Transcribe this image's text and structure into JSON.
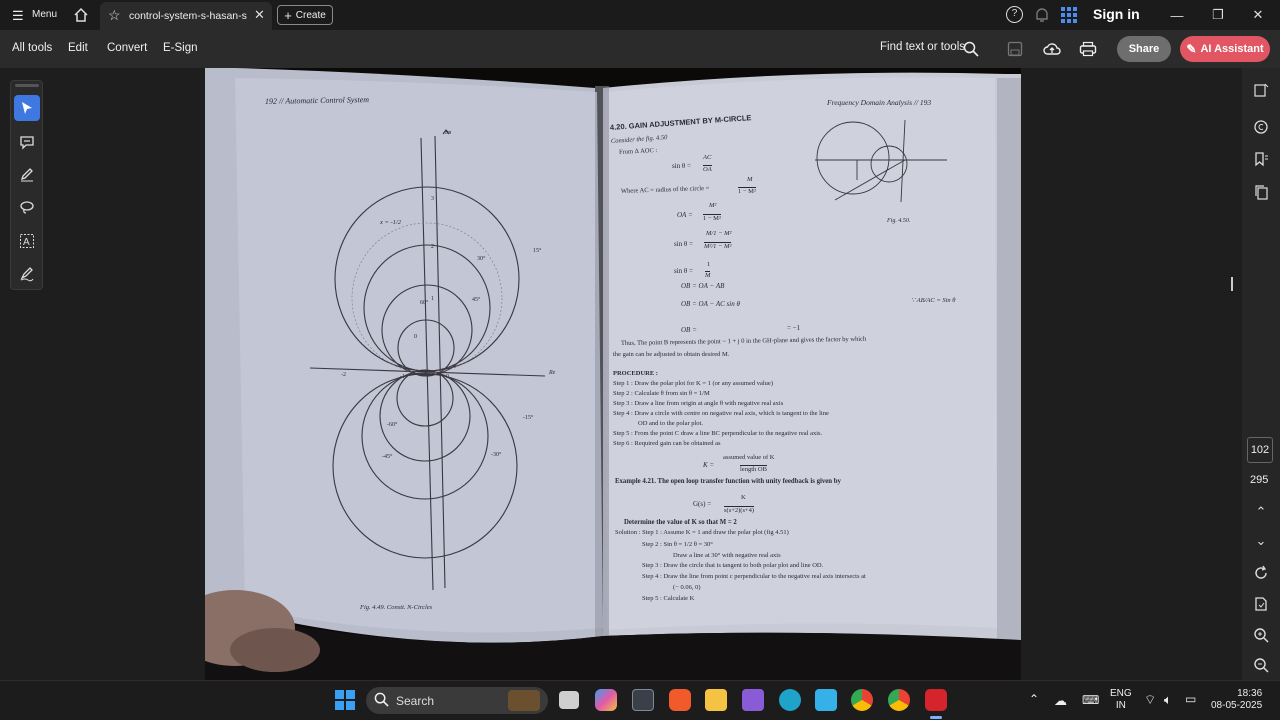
{
  "titlebar": {
    "menu_label": "Menu",
    "tab_title": "control-system-s-hasan-s...",
    "create_label": "Create",
    "signin_label": "Sign in"
  },
  "toolbar": {
    "items": [
      "All tools",
      "Edit",
      "Convert",
      "E-Sign"
    ],
    "find_label": "Find text or tools",
    "share_label": "Share",
    "ai_label": "AI Assistant"
  },
  "page_nav": {
    "current": "102",
    "total": "295"
  },
  "taskbar": {
    "search_label": "Search",
    "lang_line1": "ENG",
    "lang_line2": "IN",
    "time": "18:36",
    "date": "08-05-2025"
  },
  "document": {
    "left_header": "192 // Automatic Control System",
    "left_caption": "Fig. 4.49. Constt. N-Circles",
    "left_labels": {
      "axis_im": "Im",
      "axis_re": "Re",
      "x_label": "x = -1/2",
      "t1": "3",
      "t2": "2",
      "t3": "1",
      "t4": "0",
      "n2": "-2",
      "n1": "-1",
      "p0": "0",
      "a30": "30°",
      "a15": "15°",
      "a45": "45°",
      "a60": "60°",
      "m15": "-15°",
      "m60": "-60°",
      "m45": "-45°",
      "m30": "-30°"
    },
    "right_header": "Frequency Domain Analysis // 193",
    "section_title": "4.20. GAIN ADJUSTMENT BY M-CIRCLE",
    "consider": "Consider the fig. 4.50",
    "from_aoc": "From Δ AOC :",
    "sin_theta": "sin θ =",
    "frac_ac": "AC",
    "frac_oa": "OA",
    "where_ac": "Where AC = radius of the circle =",
    "frac_m": "M",
    "frac_1m2": "1 − M²",
    "oa_eq": "OA =",
    "frac_m2": "M²",
    "frac_1m2b": "1 − M²",
    "sin_theta2": "sin θ =",
    "frac_m_1m2": "M/1 − M²",
    "frac_m2_1m2": "M²/1 − M²",
    "sin_theta3": "sin θ =",
    "frac_1": "1",
    "frac_M": "M",
    "ob1": "OB = OA − AB",
    "ob2": "OB = OA − AC sin θ",
    "ab_ac": "∵ AB/AC = Sin θ",
    "ob3": "OB =",
    "ob3_rest": "= −1",
    "fig_label": "Fig. 4.50.",
    "thus": "Thus, The point B represents the point − 1 + j 0 in the GH-plane and gives the factor by which",
    "thus2": "the gain can be adjusted to obtain desired M.",
    "procedure": "PROCEDURE :",
    "step1": "Step 1 :  Draw the polar plot for K = 1 (or any assumed value)",
    "step2": "Step 2 :  Calculate θ from sin θ = 1/M",
    "step3": "Step 3 :  Draw a line from origin at angle θ with negative real axis",
    "step4": "Step 4 :  Draw a circle with centre on negative real axis, which is tangent to the line",
    "step4b": "OD and to the polar plot.",
    "step5": "Step 5 :  From the point C draw a line BC perpendicular to the negative real axis.",
    "step6": "Step 6 :  Required gain can be obtained as",
    "k_eq": "K =",
    "k_num": "assumed value of K",
    "k_den": "length OB",
    "example": "Example 4.21. The open loop transfer function with unity feedback is given by",
    "gs": "G(s) =",
    "gs_num": "K",
    "gs_den": "s(s+2)(s+4)",
    "determine": "Determine the value of K so that M = 2",
    "sol1": "Solution : Step 1 :  Assume K = 1 and draw the polar plot (fig 4.51)",
    "sol2": "Step 2 :  Sin θ = 1/2        θ = 30°",
    "sol2b": "Draw a line at 30° with negative real axis",
    "sol3": "Step 3 :  Draw the circle that is tangent to both polar plot and line OD.",
    "sol4": "Step 4 :  Draw the line from point c perpendicular to the negative real  axis intersects at",
    "sol4b": "(− 0.06, 0)",
    "sol5": "Step 5 :  Calculate K"
  }
}
